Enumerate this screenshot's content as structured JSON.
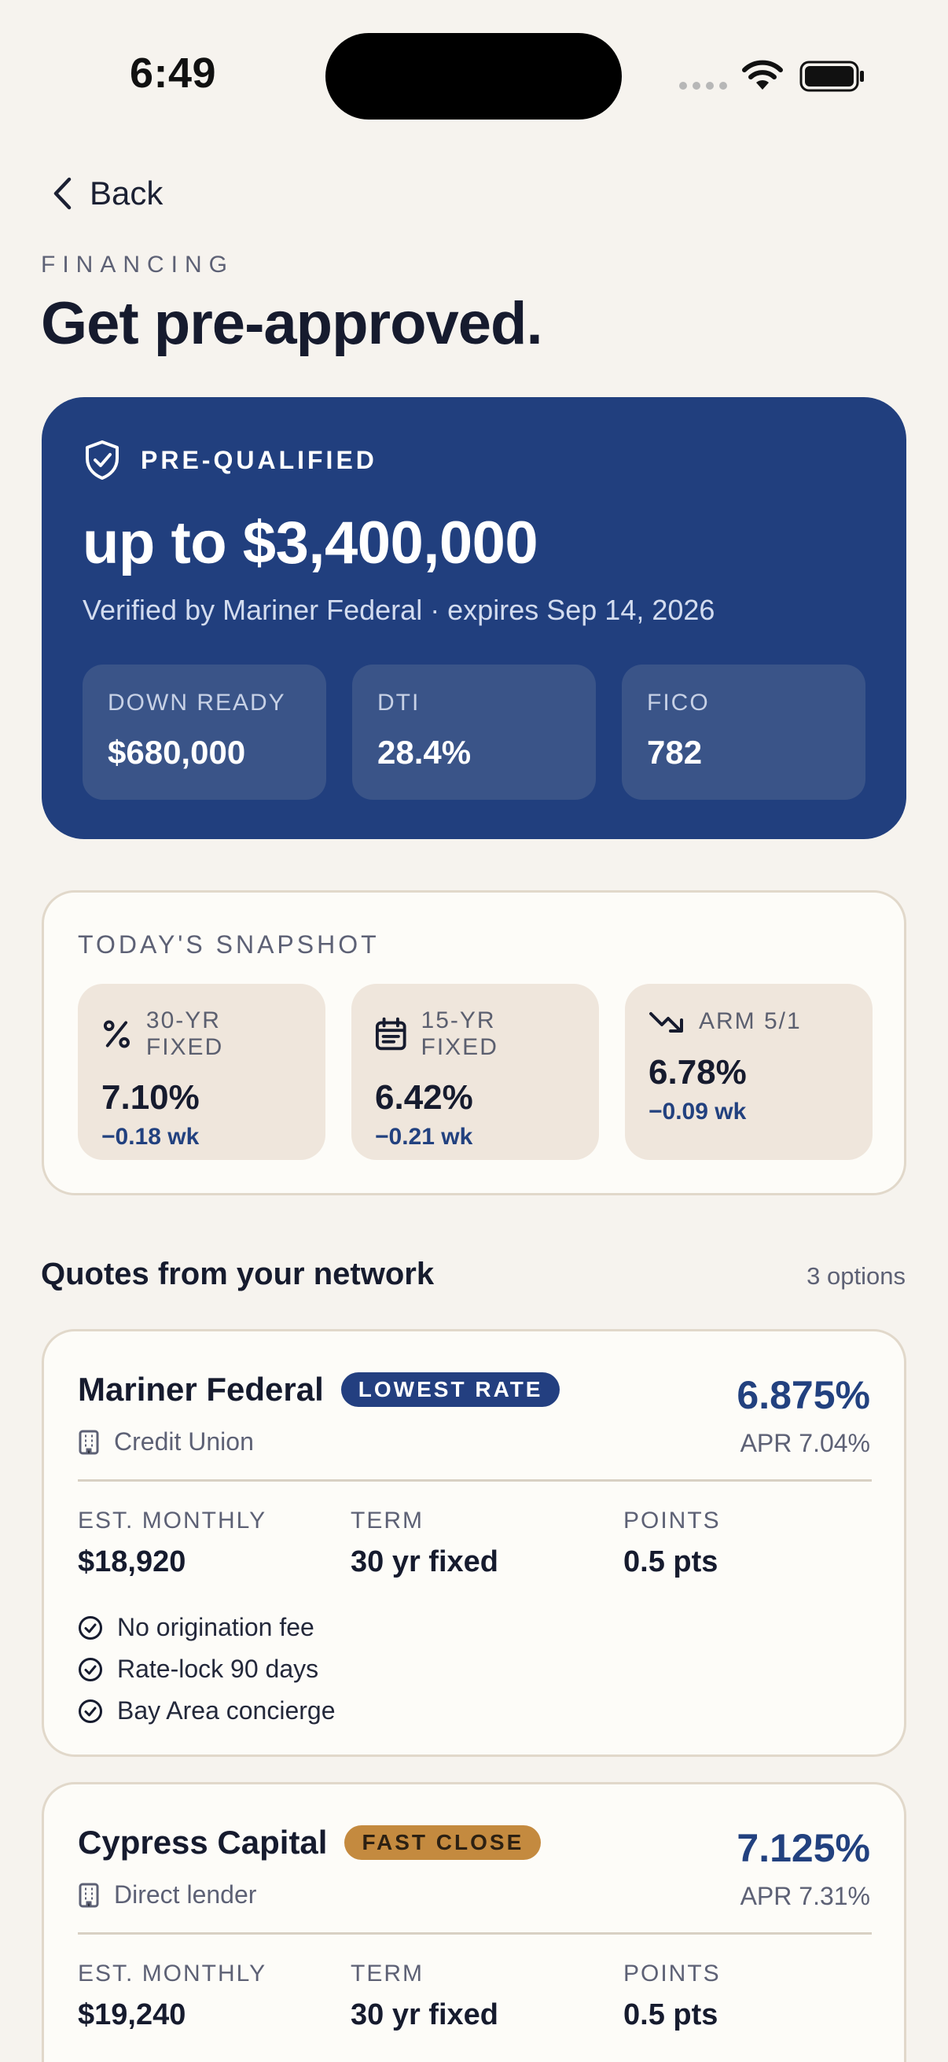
{
  "status_bar": {
    "time": "6:49"
  },
  "nav": {
    "back_label": "Back"
  },
  "header": {
    "eyebrow": "FINANCING",
    "title": "Get pre-approved."
  },
  "hero": {
    "badge": "PRE-QUALIFIED",
    "amount": "up to $3,400,000",
    "verified": "Verified by Mariner Federal · expires Sep 14, 2026",
    "stats": [
      {
        "label": "DOWN READY",
        "value": "$680,000"
      },
      {
        "label": "DTI",
        "value": "28.4%"
      },
      {
        "label": "FICO",
        "value": "782"
      }
    ]
  },
  "snapshot": {
    "title": "TODAY'S SNAPSHOT",
    "tiles": [
      {
        "icon": "percent-icon",
        "label": "30-YR FIXED",
        "rate": "7.10%",
        "change": "−0.18 wk"
      },
      {
        "icon": "calendar-icon",
        "label": "15-YR FIXED",
        "rate": "6.42%",
        "change": "−0.21 wk"
      },
      {
        "icon": "trending-down-icon",
        "label": "ARM 5/1",
        "rate": "6.78%",
        "change": "−0.09 wk"
      }
    ]
  },
  "quotes_section": {
    "title": "Quotes from your network",
    "count": "3 options"
  },
  "quotes": [
    {
      "name": "Mariner Federal",
      "badge": "LOWEST RATE",
      "badge_color": "#233f80",
      "type": "Credit Union",
      "rate": "6.875%",
      "apr": "APR 7.04%",
      "cols": [
        {
          "label": "EST. MONTHLY",
          "value": "$18,920"
        },
        {
          "label": "TERM",
          "value": "30 yr fixed"
        },
        {
          "label": "POINTS",
          "value": "0.5 pts"
        }
      ],
      "features": [
        "No origination fee",
        "Rate-lock 90 days",
        "Bay Area concierge"
      ]
    },
    {
      "name": "Cypress Capital",
      "badge": "FAST CLOSE",
      "badge_color": "#c48a3f",
      "type": "Direct lender",
      "rate": "7.125%",
      "apr": "APR 7.31%",
      "cols": [
        {
          "label": "EST. MONTHLY",
          "value": "$19,240"
        },
        {
          "label": "TERM",
          "value": "30 yr fixed"
        },
        {
          "label": "POINTS",
          "value": "0.5 pts"
        }
      ]
    }
  ],
  "colors": {
    "background": "#f6f3ee",
    "brand_navy": "#213f7e",
    "accent_gold": "#c48a3f",
    "text_dark": "#161b2e"
  }
}
